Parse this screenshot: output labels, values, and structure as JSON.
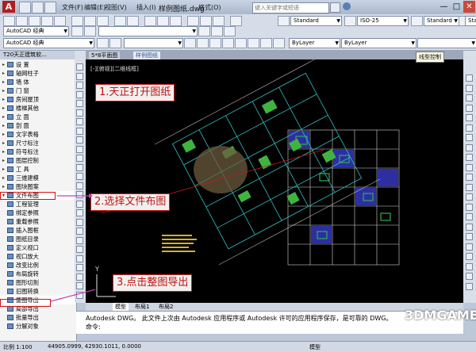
{
  "app": {
    "logo_letter": "A",
    "doc_title": "样例图纸.dwg",
    "search_placeholder": "键入关键字或短语",
    "menus": [
      "文件(F)",
      "编辑(E)",
      "视图(V)",
      "插入(I)",
      "格式(O)"
    ],
    "window_controls": [
      "—",
      "□",
      "✕"
    ]
  },
  "toolbar": {
    "workspace": "AutoCAD 经典",
    "text_style": "Standard",
    "dim_style": "ISO-25",
    "linetype": "ByLayer",
    "lineweight": "ByLayer",
    "color_tooltip": "线型控制",
    "style_tail": "Sta"
  },
  "left_panel": {
    "title": "T20天正建筑软...",
    "items": [
      {
        "label": "设    置",
        "expand": true
      },
      {
        "label": "轴网柱子",
        "expand": true
      },
      {
        "label": "墙    体",
        "expand": true
      },
      {
        "label": "门    窗",
        "expand": true
      },
      {
        "label": "房间屋顶",
        "expand": true
      },
      {
        "label": "楼梯其他",
        "expand": true
      },
      {
        "label": "立    面",
        "expand": true
      },
      {
        "label": "剖    面",
        "expand": true
      },
      {
        "label": "文字表格",
        "expand": true
      },
      {
        "label": "尺寸标注",
        "expand": true
      },
      {
        "label": "符号标注",
        "expand": true
      },
      {
        "label": "图层控制",
        "expand": true
      },
      {
        "label": "工    具",
        "expand": true
      },
      {
        "label": "三维建模",
        "expand": true
      },
      {
        "label": "图块图案",
        "expand": true
      },
      {
        "label": "文件布图",
        "expand": false
      },
      {
        "label": "工程管理",
        "expand": false
      },
      {
        "label": "绑定参照",
        "expand": false
      },
      {
        "label": "重载参照",
        "expand": false
      },
      {
        "label": "插入图框",
        "expand": false
      },
      {
        "label": "图纸目录",
        "expand": false
      },
      {
        "label": "定义视口",
        "expand": false
      },
      {
        "label": "视口放大",
        "expand": false
      },
      {
        "label": "改变比例",
        "expand": false
      },
      {
        "label": "布局旋转",
        "expand": false
      },
      {
        "label": "图形切割",
        "expand": false
      },
      {
        "label": "旧图转换",
        "expand": false
      },
      {
        "label": "整图导出",
        "expand": false
      },
      {
        "label": "局部导出",
        "expand": false
      },
      {
        "label": "批量导出",
        "expand": false
      },
      {
        "label": "分解对象",
        "expand": false
      }
    ]
  },
  "drawing": {
    "top_tabs": [
      "5*8平面图",
      "样例图纸"
    ],
    "viewport_label": "[-][俯视][二维线框]",
    "ucs_y": "Y",
    "layout_tabs": [
      "模型",
      "布局1",
      "布局2"
    ]
  },
  "callouts": {
    "step1": "1.天正打开图纸",
    "step2": "2.选择文件布图",
    "step3": "3.点击整图导出"
  },
  "command": {
    "line1": "Autodesk DWG。  此文件上次由 Autodesk 应用程序或 Autodesk 许可的应用程序保存，是可靠的 DWG。",
    "prompt": "命令:"
  },
  "status": {
    "scale": "比例 1:100",
    "coords": "44905.0999, 42930.1011, 0.0000",
    "model_label": "模型"
  },
  "watermark": "3DMGAME"
}
